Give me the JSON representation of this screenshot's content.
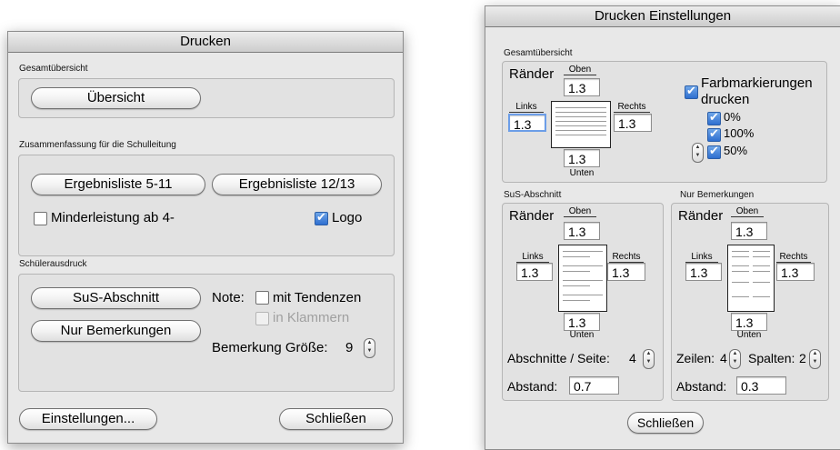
{
  "left_window": {
    "title": "Drucken",
    "section_overview": {
      "label": "Gesamtübersicht",
      "button_overview": "Übersicht"
    },
    "section_summary": {
      "label": "Zusammenfassung für die Schulleitung",
      "button_results_5_11": "Ergebnisliste 5-11",
      "button_results_12_13": "Ergebnisliste 12/13",
      "checkbox_underperformance": {
        "label": "Minderleistung ab 4-",
        "checked": false
      },
      "checkbox_logo": {
        "label": "Logo",
        "checked": true
      }
    },
    "section_student_print": {
      "label": "Schülerausdruck",
      "button_sus_section": "SuS-Abschnitt",
      "button_remarks_only": "Nur Bemerkungen",
      "note_label": "Note:",
      "checkbox_tendencies": {
        "label": "mit Tendenzen",
        "checked": false
      },
      "checkbox_brackets": {
        "label": "in Klammern",
        "checked": false,
        "disabled": true
      },
      "remark_size_label": "Bemerkung Größe:",
      "remark_size_value": "9"
    },
    "button_settings": "Einstellungen...",
    "button_close": "Schließen"
  },
  "right_window": {
    "title": "Drucken Einstellungen",
    "overview": {
      "label": "Gesamtübersicht",
      "margins_label": "Ränder",
      "top_label": "Oben",
      "top_value": "1.3",
      "left_label": "Links",
      "left_value": "1.3",
      "right_label": "Rechts",
      "right_value": "1.3",
      "bottom_label": "Unten",
      "bottom_value": "1.3",
      "color_marking_label_1": "Farbmarkierungen",
      "color_marking_label_2": "drucken",
      "color_marking_checked": true,
      "pct_0": "0%",
      "pct_100": "100%",
      "pct_50": "50%"
    },
    "sus": {
      "label": "SuS-Abschnitt",
      "margins_label": "Ränder",
      "top_label": "Oben",
      "top_value": "1.3",
      "left_label": "Links",
      "left_value": "1.3",
      "right_label": "Rechts",
      "right_value": "1.3",
      "bottom_label": "Unten",
      "bottom_value": "1.3",
      "sections_per_page_label": "Abschnitte / Seite:",
      "sections_per_page_value": "4",
      "spacing_label": "Abstand:",
      "spacing_value": "0.7"
    },
    "remarks": {
      "label": "Nur Bemerkungen",
      "margins_label": "Ränder",
      "top_label": "Oben",
      "top_value": "1.3",
      "left_label": "Links",
      "left_value": "1.3",
      "right_label": "Rechts",
      "right_value": "1.3",
      "bottom_label": "Unten",
      "bottom_value": "1.3",
      "rows_label": "Zeilen:",
      "rows_value": "4",
      "cols_label": "Spalten:",
      "cols_value": "2",
      "spacing_label": "Abstand:",
      "spacing_value": "0.3"
    },
    "button_close": "Schließen"
  }
}
